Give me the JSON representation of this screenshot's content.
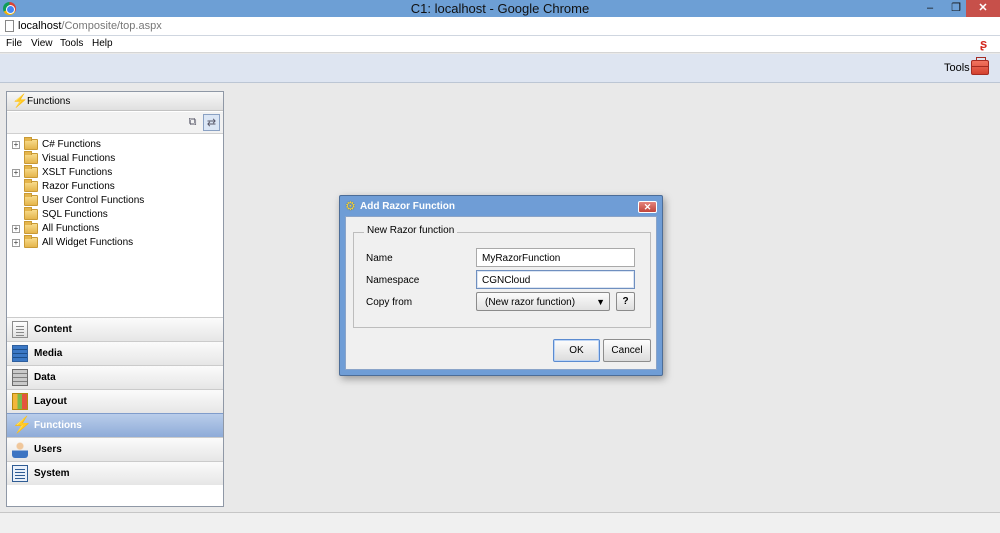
{
  "window": {
    "title": "C1: localhost - Google Chrome",
    "minimize_glyph": "–",
    "maximize_glyph": "❐",
    "close_glyph": "✕"
  },
  "address": {
    "host": "localhost",
    "path": "/Composite/top.aspx"
  },
  "menu": {
    "items": [
      "File",
      "View",
      "Tools",
      "Help"
    ]
  },
  "toolbar": {
    "tools_label": "Tools"
  },
  "left_panel": {
    "header": "Functions",
    "tree": [
      {
        "label": "C# Functions",
        "expandable": true
      },
      {
        "label": "Visual Functions",
        "expandable": false
      },
      {
        "label": "XSLT Functions",
        "expandable": true
      },
      {
        "label": "Razor Functions",
        "expandable": false
      },
      {
        "label": "User Control Functions",
        "expandable": false
      },
      {
        "label": "SQL Functions",
        "expandable": false
      },
      {
        "label": "All Functions",
        "expandable": true
      },
      {
        "label": "All Widget Functions",
        "expandable": true
      }
    ],
    "nav": [
      {
        "label": "Content",
        "icon": "content-icon"
      },
      {
        "label": "Media",
        "icon": "media-icon"
      },
      {
        "label": "Data",
        "icon": "data-icon"
      },
      {
        "label": "Layout",
        "icon": "layout-icon"
      },
      {
        "label": "Functions",
        "icon": "functions-icon",
        "active": true
      },
      {
        "label": "Users",
        "icon": "users-icon"
      },
      {
        "label": "System",
        "icon": "system-icon"
      }
    ]
  },
  "dialog": {
    "title": "Add Razor Function",
    "group_label": "New Razor function",
    "name_label": "Name",
    "name_value": "MyRazorFunction",
    "namespace_label": "Namespace",
    "namespace_value": "CGNCloud",
    "copy_from_label": "Copy from",
    "copy_from_value": "(New razor function)",
    "help_label": "?",
    "ok_label": "OK",
    "cancel_label": "Cancel"
  }
}
